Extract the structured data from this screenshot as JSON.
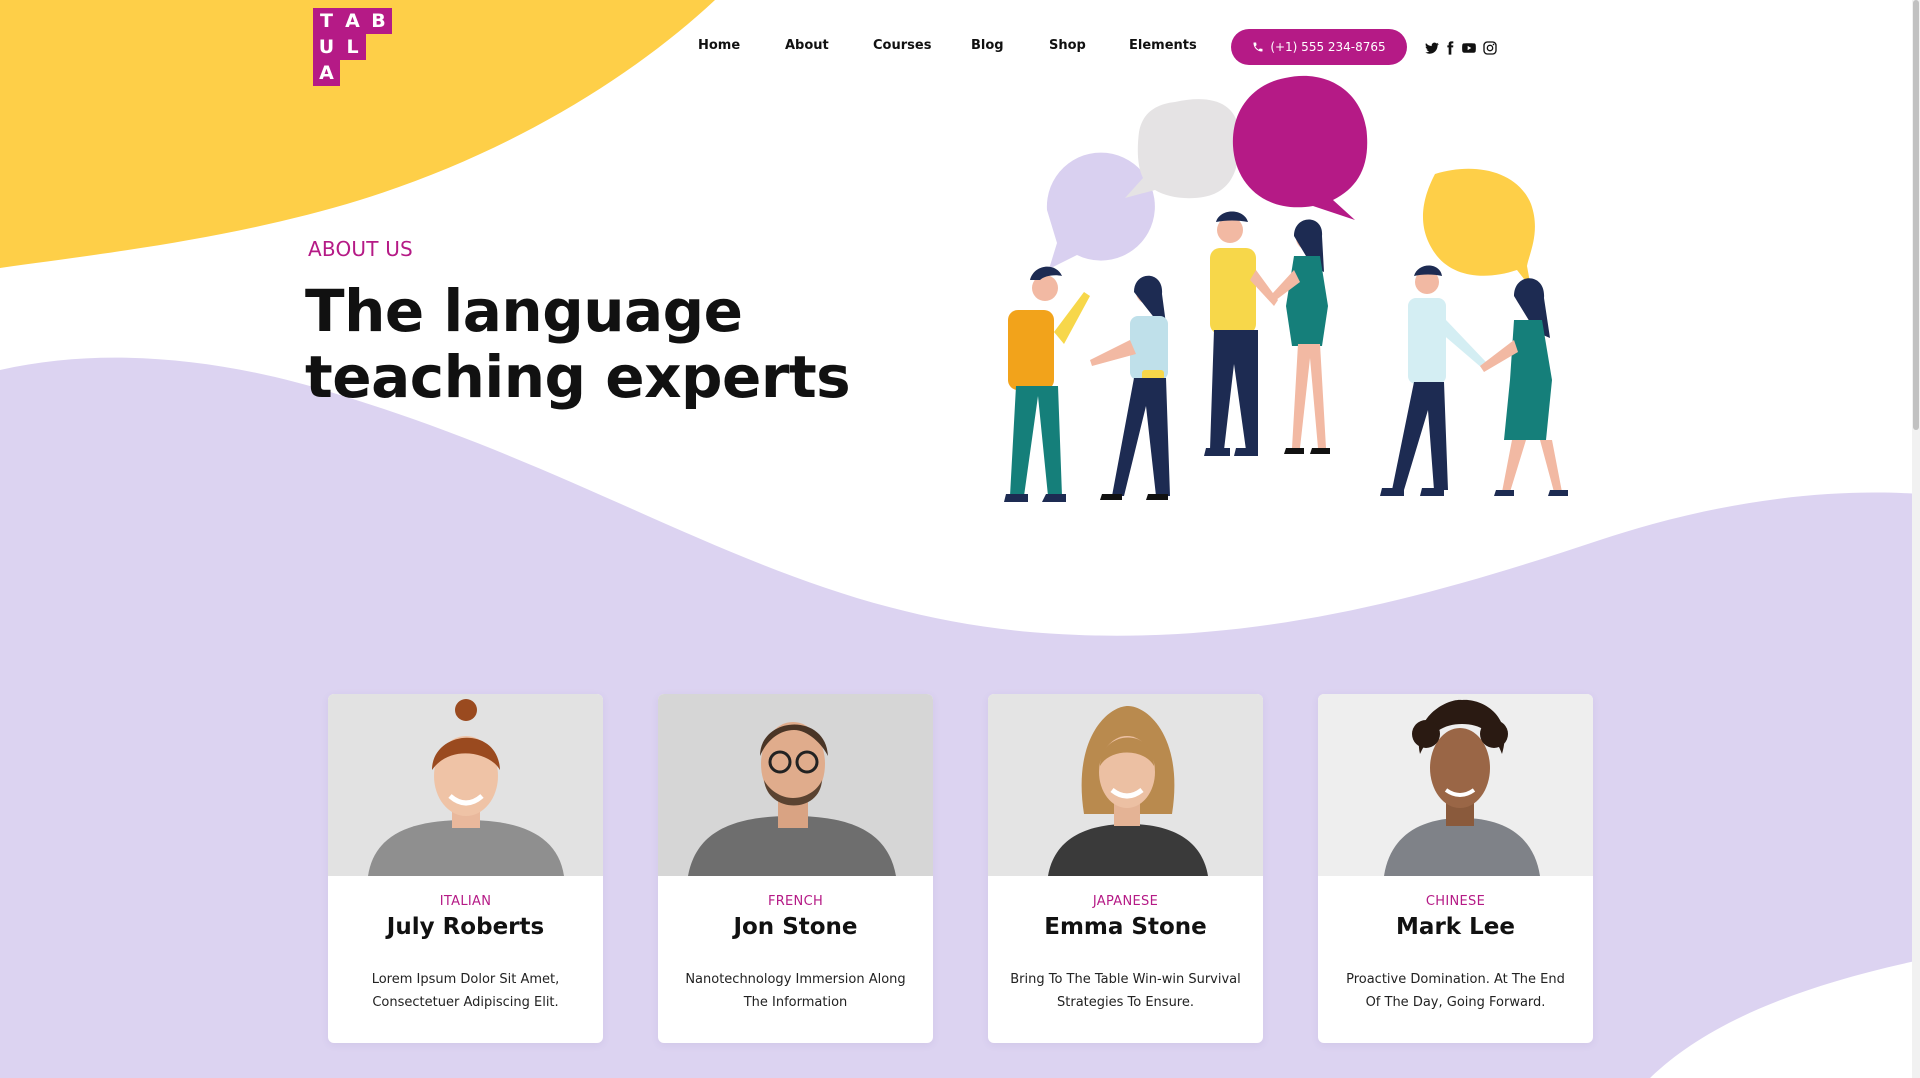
{
  "colors": {
    "brand": "#b51a86",
    "yellow": "#fecf48",
    "lavender": "#dcd3f1",
    "text": "#111111"
  },
  "logo": {
    "letters": [
      "T",
      "A",
      "B",
      "U",
      "L",
      "A"
    ]
  },
  "nav": {
    "items": [
      {
        "label": "Home"
      },
      {
        "label": "About"
      },
      {
        "label": "Courses"
      },
      {
        "label": "Blog"
      },
      {
        "label": "Shop"
      },
      {
        "label": "Elements"
      }
    ],
    "phone": {
      "icon": "phone-icon",
      "label": "(+1) 555 234-8765"
    },
    "social": [
      {
        "icon": "twitter-icon"
      },
      {
        "icon": "facebook-icon"
      },
      {
        "icon": "youtube-icon"
      },
      {
        "icon": "instagram-icon"
      }
    ]
  },
  "hero": {
    "eyebrow": "ABOUT US",
    "headline_line1": "The language",
    "headline_line2": "teaching experts"
  },
  "teachers": [
    {
      "language": "ITALIAN",
      "name": "July Roberts",
      "description": "Lorem Ipsum Dolor Sit Amet, Consectetuer Adipiscing Elit."
    },
    {
      "language": "FRENCH",
      "name": "Jon Stone",
      "description": "Nanotechnology Immersion Along The Information"
    },
    {
      "language": "JAPANESE",
      "name": "Emma Stone",
      "description": "Bring To The Table Win-win Survival Strategies To Ensure."
    },
    {
      "language": "CHINESE",
      "name": "Mark Lee",
      "description": "Proactive Domination. At The End Of The Day, Going Forward."
    }
  ]
}
